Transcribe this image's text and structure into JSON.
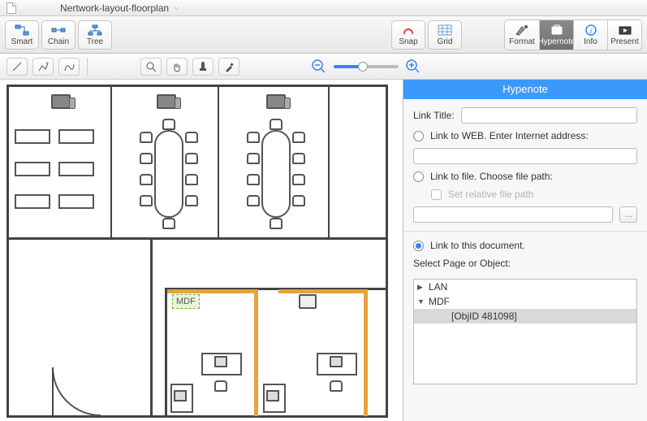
{
  "titlebar": {
    "document_name": "Nertwork-layout-floorplan"
  },
  "toolbar": {
    "left": [
      {
        "id": "smart",
        "label": "Smart"
      },
      {
        "id": "chain",
        "label": "Chain"
      },
      {
        "id": "tree",
        "label": "Tree"
      }
    ],
    "mid": [
      {
        "id": "snap",
        "label": "Snap"
      },
      {
        "id": "grid",
        "label": "Grid"
      }
    ],
    "right": [
      {
        "id": "format",
        "label": "Format"
      },
      {
        "id": "hypernote",
        "label": "Hypernote",
        "active": true
      },
      {
        "id": "info",
        "label": "Info"
      },
      {
        "id": "present",
        "label": "Present"
      }
    ]
  },
  "inspector": {
    "header": "Hypenote",
    "link_title_label": "Link Title:",
    "link_title_value": "",
    "opt_web_label": "Link to WEB. Enter Internet address:",
    "web_value": "",
    "opt_file_label": "Link to file. Choose file path:",
    "set_relative_label": "Set relative file path",
    "file_value": "",
    "browse_label": "...",
    "opt_doc_label": "Link to this document.",
    "selected_option": "doc",
    "select_page_label": "Select Page or Object:",
    "tree": [
      {
        "label": "LAN",
        "expanded": false,
        "depth": 0
      },
      {
        "label": "MDF",
        "expanded": true,
        "depth": 0
      },
      {
        "label": "[ObjID 481098]",
        "depth": 1,
        "selected": true
      }
    ]
  },
  "canvas": {
    "mdf_label": "MDF"
  }
}
